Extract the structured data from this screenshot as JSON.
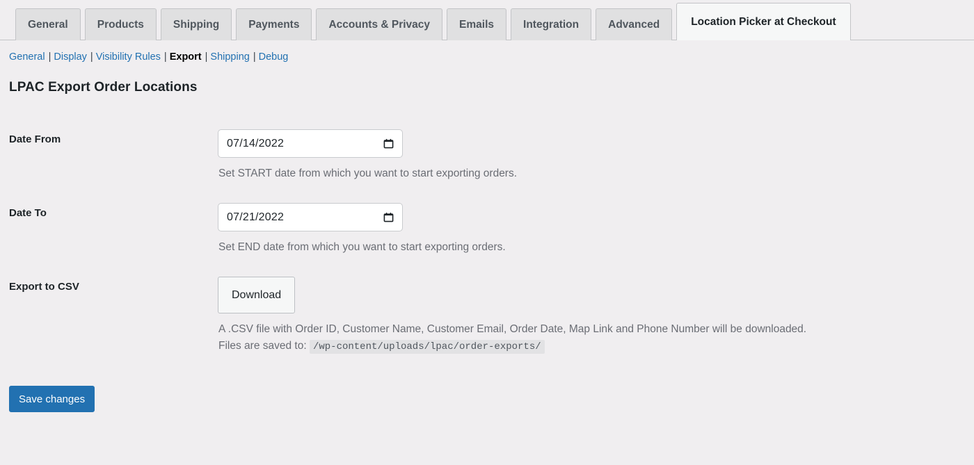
{
  "tabs": [
    {
      "label": "General",
      "active": false
    },
    {
      "label": "Products",
      "active": false
    },
    {
      "label": "Shipping",
      "active": false
    },
    {
      "label": "Payments",
      "active": false
    },
    {
      "label": "Accounts & Privacy",
      "active": false
    },
    {
      "label": "Emails",
      "active": false
    },
    {
      "label": "Integration",
      "active": false
    },
    {
      "label": "Advanced",
      "active": false
    },
    {
      "label": "Location Picker at Checkout",
      "active": true
    }
  ],
  "subnav": {
    "items": [
      {
        "label": "General",
        "current": false
      },
      {
        "label": "Display",
        "current": false
      },
      {
        "label": "Visibility Rules",
        "current": false
      },
      {
        "label": "Export",
        "current": true
      },
      {
        "label": "Shipping",
        "current": false
      },
      {
        "label": "Debug",
        "current": false
      }
    ],
    "separator": "|"
  },
  "page": {
    "title": "LPAC Export Order Locations"
  },
  "fields": {
    "date_from": {
      "label": "Date From",
      "value": "07/14/2022",
      "description": "Set START date from which you want to start exporting orders."
    },
    "date_to": {
      "label": "Date To",
      "value": "07/21/2022",
      "description": "Set END date from which you want to start exporting orders."
    },
    "export_csv": {
      "label": "Export to CSV",
      "button_label": "Download",
      "description_line1": "A .CSV file with Order ID, Customer Name, Customer Email, Order Date, Map Link and Phone Number will be downloaded.",
      "description_line2_prefix": "Files are saved to:",
      "path": "/wp-content/uploads/lpac/order-exports/"
    }
  },
  "actions": {
    "save_label": "Save changes"
  },
  "colors": {
    "page_background": "#f0eef0",
    "link": "#2271b1",
    "primary_button": "#2271b1",
    "tab_inactive": "#e0e0e1",
    "tab_active": "#f6f7f7",
    "description_text": "#6a6d74"
  }
}
